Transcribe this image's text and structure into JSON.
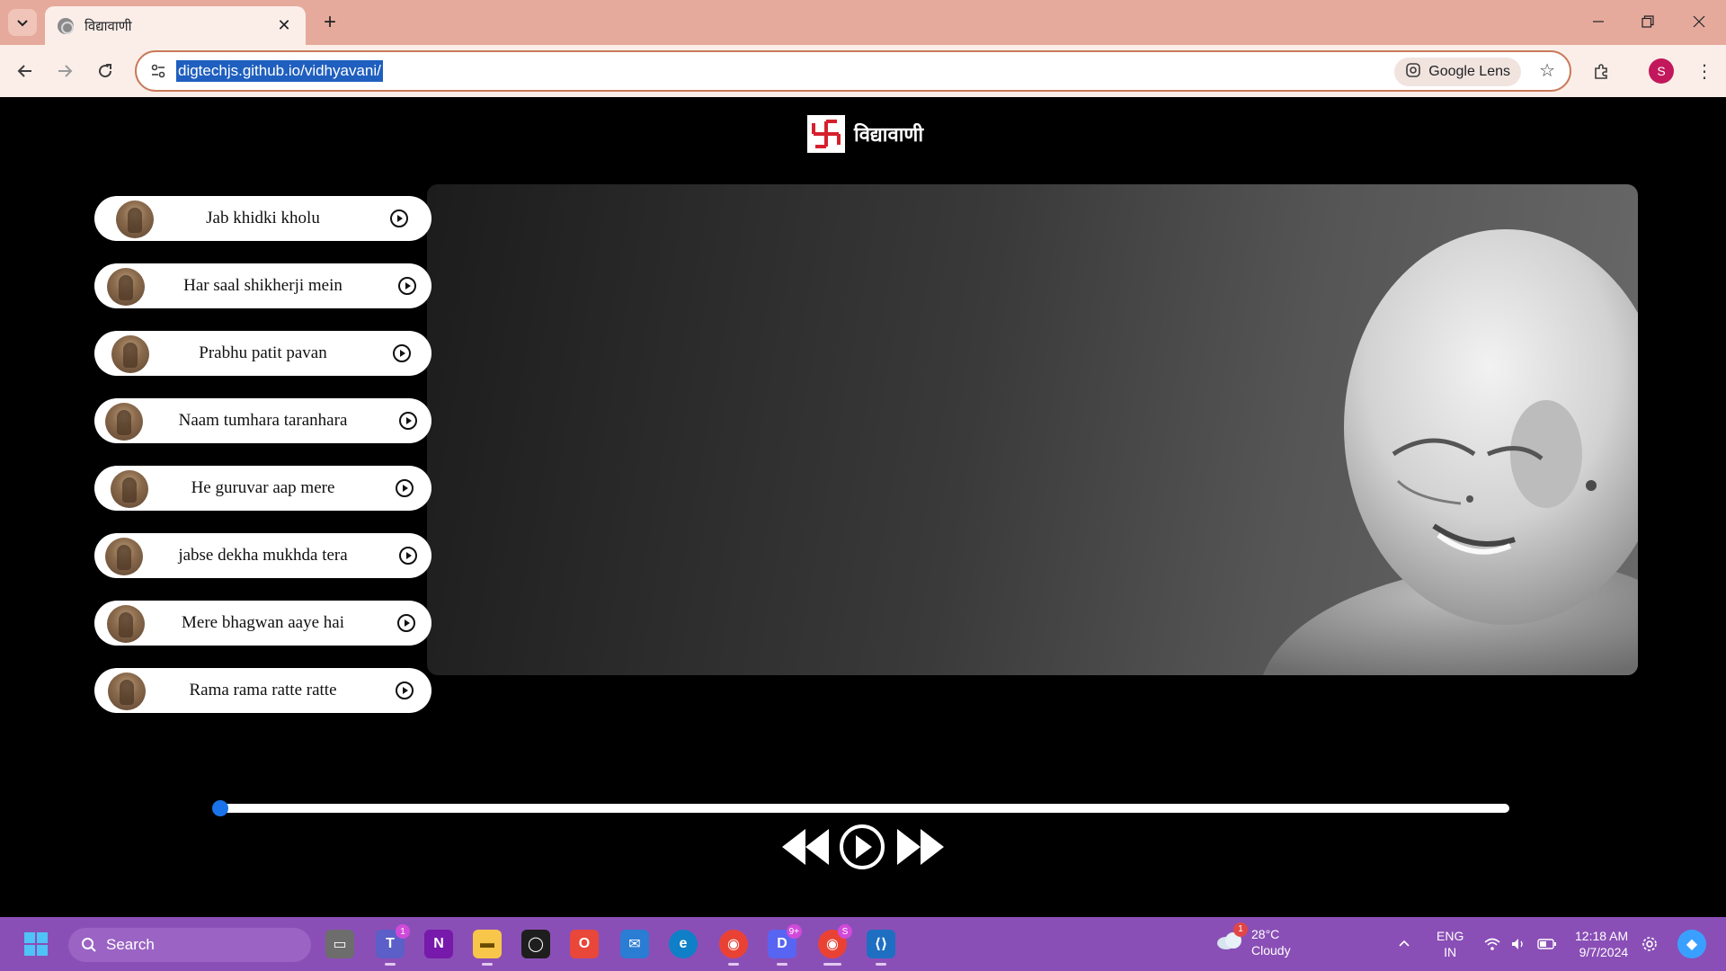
{
  "browser": {
    "tab_title": "विद्यावाणी",
    "url": "digtechjs.github.io/vidhyavani/",
    "lens_label": "Google Lens",
    "profile_initial": "S"
  },
  "page": {
    "brand_name": "विद्यावाणी",
    "songs": [
      {
        "title": "Jab khidki kholu"
      },
      {
        "title": "Har saal shikherji mein"
      },
      {
        "title": "Prabhu patit pavan"
      },
      {
        "title": "Naam tumhara taranhara"
      },
      {
        "title": "He guruvar aap mere"
      },
      {
        "title": "jabse dekha mukhda tera"
      },
      {
        "title": "Mere bhagwan aaye hai"
      },
      {
        "title": "Rama rama ratte ratte"
      }
    ],
    "progress_fraction": 0.0,
    "colors": {
      "accent": "#1a73e8",
      "logo_red": "#d6202e"
    }
  },
  "taskbar": {
    "search_label": "Search",
    "teams_badge": "1",
    "discord_badge": "9+",
    "chrome_badge": "S",
    "weather_badge": "1",
    "temperature": "28°C",
    "weather_condition": "Cloudy",
    "lang_top": "ENG",
    "lang_bottom": "IN",
    "time": "12:18 AM",
    "date": "9/7/2024"
  }
}
